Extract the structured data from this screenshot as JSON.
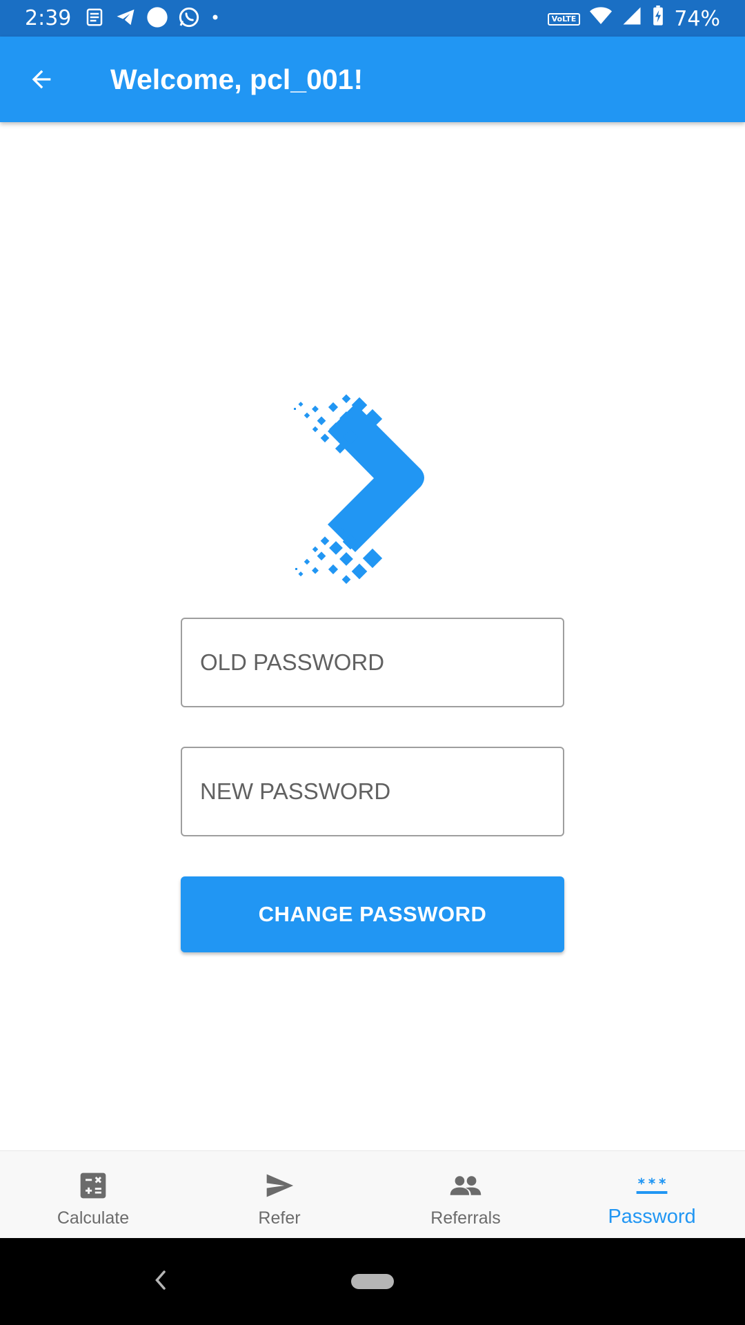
{
  "status_bar": {
    "time": "2:39",
    "network": "VoLTE",
    "battery": "74%"
  },
  "app_bar": {
    "title": "Welcome, pcl_001!"
  },
  "form": {
    "old_password_placeholder": "OLD PASSWORD",
    "old_password_value": "",
    "new_password_placeholder": "NEW PASSWORD",
    "new_password_value": "",
    "submit_label": "CHANGE PASSWORD"
  },
  "bottom_nav": {
    "items": [
      {
        "label": "Calculate",
        "icon": "calculator-icon",
        "active": false
      },
      {
        "label": "Refer",
        "icon": "send-icon",
        "active": false
      },
      {
        "label": "Referrals",
        "icon": "people-icon",
        "active": false
      },
      {
        "label": "Password",
        "icon": "password-icon",
        "active": true
      }
    ]
  },
  "colors": {
    "status_bar": "#1a6fc4",
    "primary": "#2196f3",
    "nav_inactive": "#6b6b6b"
  }
}
